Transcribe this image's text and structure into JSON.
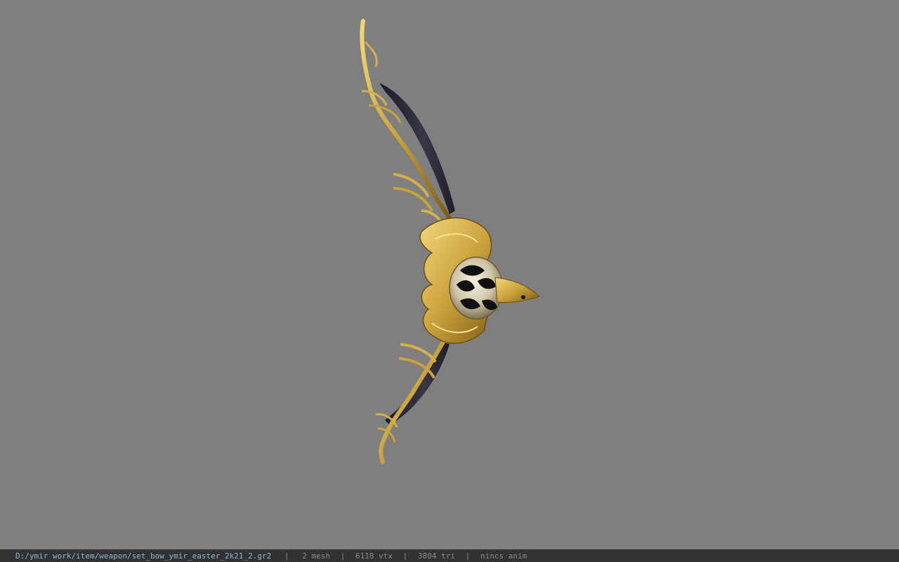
{
  "viewport": {
    "background": "#7f7f7f",
    "model_name": "bow-model"
  },
  "status_bar": {
    "file_path": "D:/ymir work/item/weapon/set_bow_ymir_easter_2k21_2.gr2",
    "separator": "|",
    "mesh_count": "2 mesh",
    "vertex_count": "6118 vtx",
    "triangle_count": "3804 tri",
    "anim_status": "nincs anim",
    "path_color": "#8fb8d6",
    "text_color": "#8a8a8a",
    "background": "#323232"
  }
}
